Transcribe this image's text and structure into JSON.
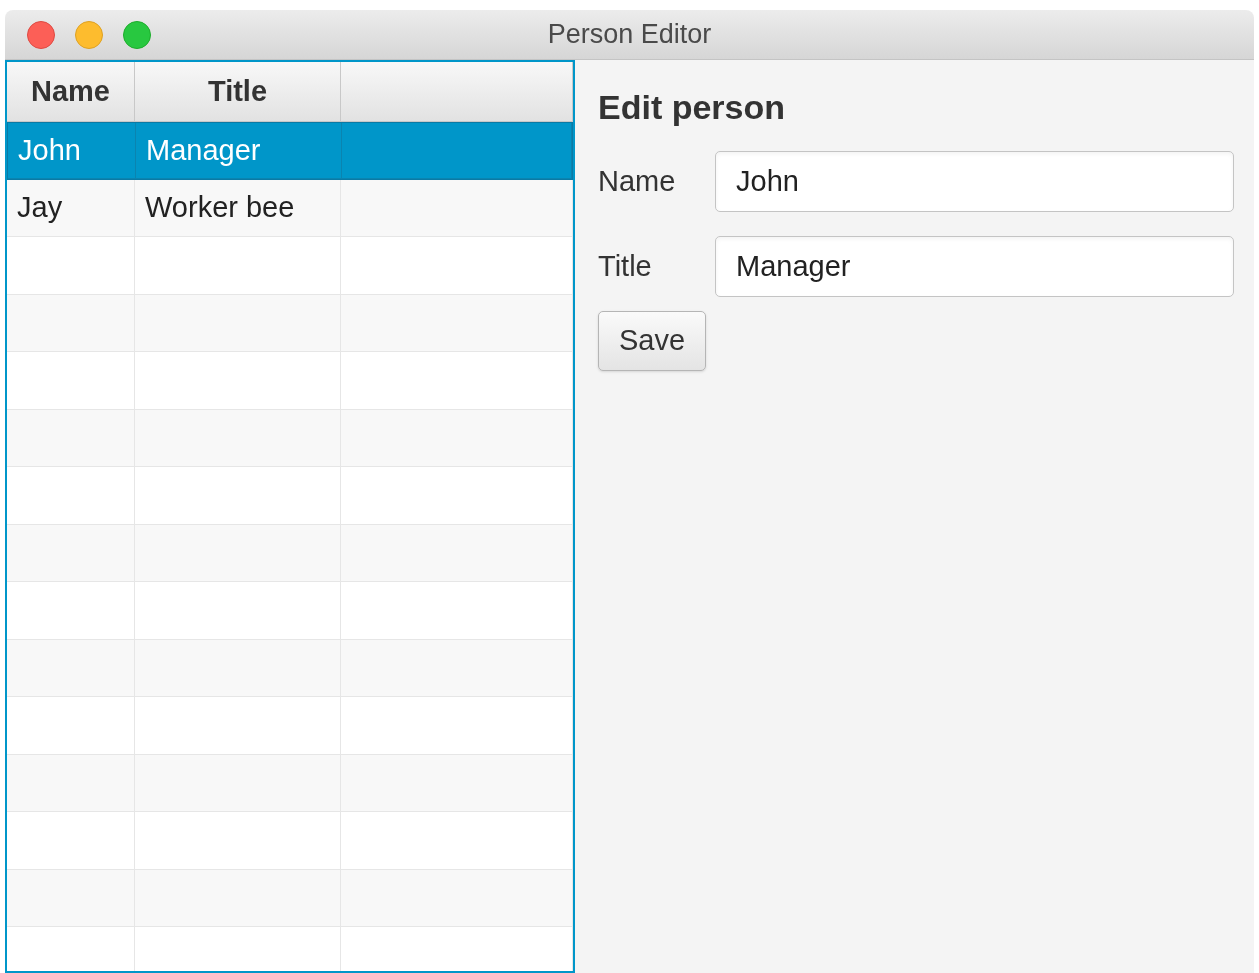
{
  "window": {
    "title": "Person Editor"
  },
  "table": {
    "columns": [
      "Name",
      "Title",
      ""
    ],
    "rows": [
      {
        "cells": [
          "John",
          "Manager"
        ],
        "selected": true
      },
      {
        "cells": [
          "Jay",
          "Worker bee"
        ],
        "selected": false
      }
    ]
  },
  "editor": {
    "heading": "Edit person",
    "fields": [
      {
        "label": "Name",
        "value": "John"
      },
      {
        "label": "Title",
        "value": "Manager"
      }
    ],
    "button": "Save"
  }
}
